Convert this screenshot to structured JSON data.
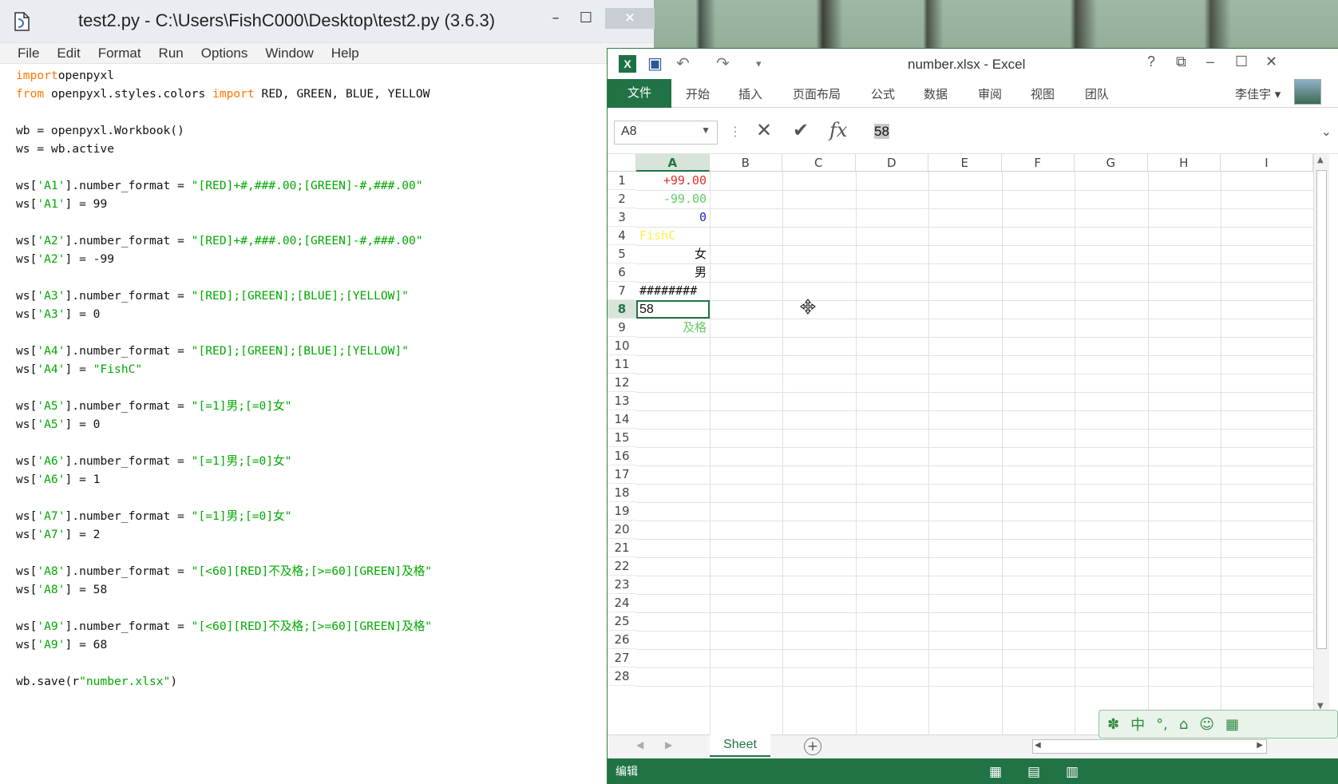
{
  "idle": {
    "title": "test2.py - C:\\Users\\FishC000\\Desktop\\test2.py (3.6.3)",
    "buttons": {
      "minimize": "–",
      "maximize": "☐",
      "close": "✕"
    },
    "menu": [
      "File",
      "Edit",
      "Format",
      "Run",
      "Options",
      "Window",
      "Help"
    ],
    "code": [
      [
        [
          "kw",
          "import"
        ],
        [
          "",
          "openpyxl"
        ]
      ],
      [
        [
          "kw",
          "from"
        ],
        [
          "",
          " openpyxl.styles.colors "
        ],
        [
          "kw",
          "import"
        ],
        [
          "",
          " RED, GREEN, BLUE, YELLOW"
        ]
      ],
      [],
      [
        [
          "",
          "wb = openpyxl.Workbook()"
        ]
      ],
      [
        [
          "",
          "ws = wb.active"
        ]
      ],
      [],
      [
        [
          "",
          "ws["
        ],
        [
          "st",
          "'A1'"
        ],
        [
          "",
          "].number_format = "
        ],
        [
          "st",
          "\"[RED]+#,###.00;[GREEN]-#,###.00\""
        ]
      ],
      [
        [
          "",
          "ws["
        ],
        [
          "st",
          "'A1'"
        ],
        [
          "",
          "] = 99"
        ]
      ],
      [],
      [
        [
          "",
          "ws["
        ],
        [
          "st",
          "'A2'"
        ],
        [
          "",
          "].number_format = "
        ],
        [
          "st",
          "\"[RED]+#,###.00;[GREEN]-#,###.00\""
        ]
      ],
      [
        [
          "",
          "ws["
        ],
        [
          "st",
          "'A2'"
        ],
        [
          "",
          "] = -99"
        ]
      ],
      [],
      [
        [
          "",
          "ws["
        ],
        [
          "st",
          "'A3'"
        ],
        [
          "",
          "].number_format = "
        ],
        [
          "st",
          "\"[RED];[GREEN];[BLUE];[YELLOW]\""
        ]
      ],
      [
        [
          "",
          "ws["
        ],
        [
          "st",
          "'A3'"
        ],
        [
          "",
          "] = 0"
        ]
      ],
      [],
      [
        [
          "",
          "ws["
        ],
        [
          "st",
          "'A4'"
        ],
        [
          "",
          "].number_format = "
        ],
        [
          "st",
          "\"[RED];[GREEN];[BLUE];[YELLOW]\""
        ]
      ],
      [
        [
          "",
          "ws["
        ],
        [
          "st",
          "'A4'"
        ],
        [
          "",
          "] = "
        ],
        [
          "st",
          "\"FishC\""
        ]
      ],
      [],
      [
        [
          "",
          "ws["
        ],
        [
          "st",
          "'A5'"
        ],
        [
          "",
          "].number_format = "
        ],
        [
          "st",
          "\"[=1]男;[=0]女\""
        ]
      ],
      [
        [
          "",
          "ws["
        ],
        [
          "st",
          "'A5'"
        ],
        [
          "",
          "] = 0"
        ]
      ],
      [],
      [
        [
          "",
          "ws["
        ],
        [
          "st",
          "'A6'"
        ],
        [
          "",
          "].number_format = "
        ],
        [
          "st",
          "\"[=1]男;[=0]女\""
        ]
      ],
      [
        [
          "",
          "ws["
        ],
        [
          "st",
          "'A6'"
        ],
        [
          "",
          "] = 1"
        ]
      ],
      [],
      [
        [
          "",
          "ws["
        ],
        [
          "st",
          "'A7'"
        ],
        [
          "",
          "].number_format = "
        ],
        [
          "st",
          "\"[=1]男;[=0]女\""
        ]
      ],
      [
        [
          "",
          "ws["
        ],
        [
          "st",
          "'A7'"
        ],
        [
          "",
          "] = 2"
        ]
      ],
      [],
      [
        [
          "",
          "ws["
        ],
        [
          "st",
          "'A8'"
        ],
        [
          "",
          "].number_format = "
        ],
        [
          "st",
          "\"[<60][RED]不及格;[>=60][GREEN]及格\""
        ]
      ],
      [
        [
          "",
          "ws["
        ],
        [
          "st",
          "'A8'"
        ],
        [
          "",
          "] = 58"
        ]
      ],
      [],
      [
        [
          "",
          "ws["
        ],
        [
          "st",
          "'A9'"
        ],
        [
          "",
          "].number_format = "
        ],
        [
          "st",
          "\"[<60][RED]不及格;[>=60][GREEN]及格\""
        ]
      ],
      [
        [
          "",
          "ws["
        ],
        [
          "st",
          "'A9'"
        ],
        [
          "",
          "] = 68"
        ]
      ],
      [],
      [
        [
          "",
          "wb.save(r"
        ],
        [
          "st",
          "\"number.xlsx\""
        ],
        [
          "",
          ")"
        ]
      ]
    ]
  },
  "excel": {
    "title": "number.xlsx - Excel",
    "title_buttons": [
      "?",
      "⧉",
      "–",
      "☐",
      "✕"
    ],
    "tabs": [
      "文件",
      "开始",
      "插入",
      "页面布局",
      "公式",
      "数据",
      "审阅",
      "视图",
      "团队"
    ],
    "user": "李佳宇 ▾",
    "name_box": "A8",
    "formula_value": "58",
    "columns": [
      "A",
      "B",
      "C",
      "D",
      "E",
      "F",
      "G",
      "H",
      "I"
    ],
    "active_column": "A",
    "active_row": 8,
    "rows": [
      "1",
      "2",
      "3",
      "4",
      "5",
      "6",
      "7",
      "8",
      "9",
      "10",
      "11",
      "12",
      "13",
      "14",
      "15",
      "16",
      "17",
      "18",
      "19",
      "20",
      "21",
      "22",
      "23",
      "24",
      "25",
      "26",
      "27",
      "28"
    ],
    "cells": [
      {
        "row": 1,
        "text": "+99.00",
        "color": "#e03030",
        "align": "right"
      },
      {
        "row": 2,
        "text": "-99.00",
        "color": "#66cc66",
        "align": "right"
      },
      {
        "row": 3,
        "text": "0",
        "color": "#2222cc",
        "align": "right"
      },
      {
        "row": 4,
        "text": "FishC",
        "color": "#ffee44",
        "align": "left"
      },
      {
        "row": 5,
        "text": "女",
        "color": "#111111",
        "align": "right"
      },
      {
        "row": 6,
        "text": "男",
        "color": "#111111",
        "align": "right"
      },
      {
        "row": 7,
        "text": "########",
        "color": "#111111",
        "align": "left"
      },
      {
        "row": 8,
        "text": "58",
        "color": "#111111",
        "align": "left",
        "selected": true
      },
      {
        "row": 9,
        "text": "及格",
        "color": "#66cc66",
        "align": "right"
      }
    ],
    "sheet_tab": "Sheet",
    "status_mode": "编辑",
    "colors": {
      "accent": "#217346"
    }
  },
  "ime": [
    "中",
    "°,",
    "⌂",
    "☺",
    "▦"
  ]
}
